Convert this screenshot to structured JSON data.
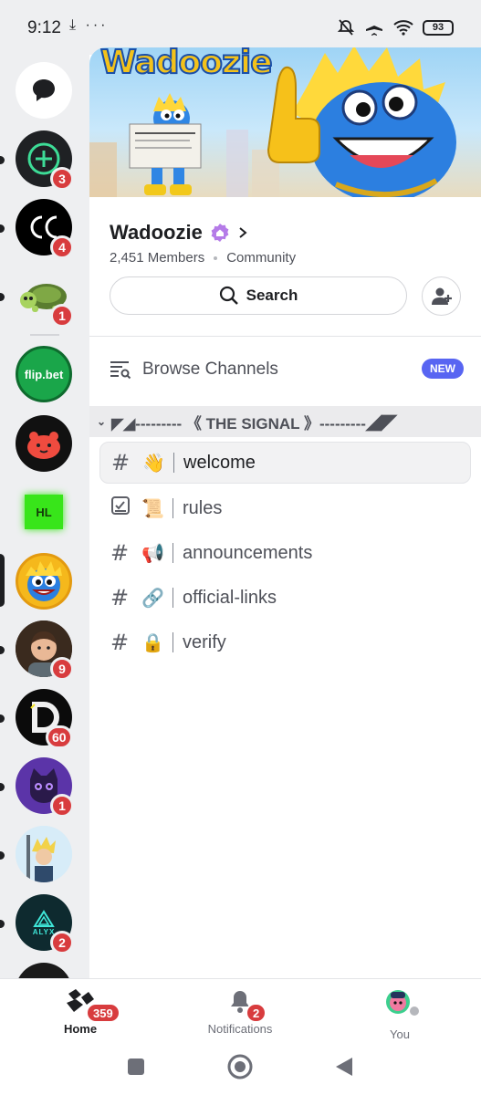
{
  "status": {
    "time": "9:12",
    "left_icons": "⤓ ···",
    "battery": "93"
  },
  "rail": {
    "badges": [
      "3",
      "4",
      "1",
      "9",
      "60",
      "1",
      "2"
    ],
    "flipbet_label": "flip.bet",
    "hl_label": "HL",
    "alyx_label": "ALYX"
  },
  "banner": {
    "title": "Wadoozie"
  },
  "server": {
    "name": "Wadoozie",
    "members": "2,451 Members",
    "type": "Community"
  },
  "search": {
    "label": "Search"
  },
  "browse": {
    "label": "Browse Channels",
    "badge": "NEW"
  },
  "category": {
    "label": "◤◢--------- 《 THE SIGNAL 》---------◢◤"
  },
  "channels": [
    {
      "emoji": "👋",
      "name": "welcome"
    },
    {
      "emoji": "📜",
      "name": "rules"
    },
    {
      "emoji": "📢",
      "name": "announcements"
    },
    {
      "emoji": "🔗",
      "name": "official-links"
    },
    {
      "emoji": "🔒",
      "name": "verify"
    }
  ],
  "nav": {
    "home": {
      "label": "Home",
      "badge": "359"
    },
    "notifications": {
      "label": "Notifications",
      "badge": "2"
    },
    "you": {
      "label": "You"
    }
  },
  "colors": {
    "accent": "#5865f2",
    "badge": "#d83c3e",
    "rail_bg": "#eeeff1"
  }
}
